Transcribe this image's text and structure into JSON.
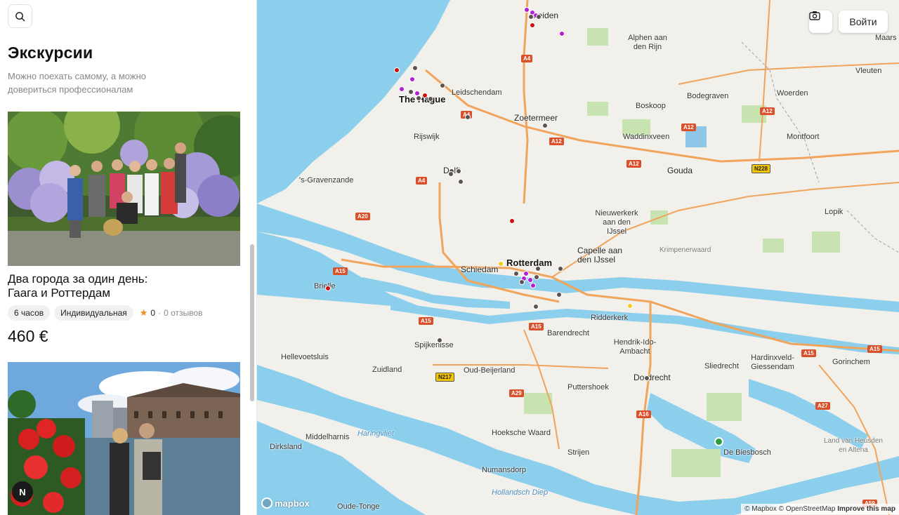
{
  "sidebar": {
    "title": "Экскурсии",
    "subtitle": "Можно поехать самому, а можно довериться профессионалам",
    "cards": [
      {
        "title": "Два города за один день: Гаага и Роттердам",
        "duration": "6 часов",
        "type": "Индивидуальная",
        "rating": "0",
        "reviews": "0 отзывов",
        "price": "460 €"
      },
      {
        "title": "",
        "duration": "",
        "type": "",
        "rating": "",
        "reviews": "",
        "price": ""
      }
    ],
    "badge": "N"
  },
  "map": {
    "login_label": "Войти",
    "mapbox_label": "mapbox",
    "attribution": {
      "mapbox": "© Mapbox",
      "osm": "© OpenStreetMap",
      "improve": "Improve this map"
    },
    "labels": {
      "leiden": "Leiden",
      "alphen": "Alphen aan den Rijn",
      "hague": "The Hague",
      "leidschendam": "Leidschendam",
      "zoetermeer": "Zoetermeer",
      "bodegraven": "Bodegraven",
      "boskoop": "Boskoop",
      "waddinxveen": "Waddinxveen",
      "rijswijk": "Rijswijk",
      "delft": "Delft",
      "gravenzande": "'s-Gravenzande",
      "gouda": "Gouda",
      "vleuten": "Vleuten",
      "woerden": "Woerden",
      "montfoort": "Montfoort",
      "lopik": "Lopik",
      "nieuwerkerk": "Nieuwerkerk aan den IJssel",
      "krimpenerwaard": "Krimpenerwaard",
      "capelle": "Capelle aan den IJssel",
      "rotterdam": "Rotterdam",
      "schiedam": "Schiedam",
      "brielle": "Brielle",
      "ridderkerk": "Ridderkerk",
      "barendrecht": "Barendrecht",
      "hendrik": "Hendrik-Ido-Ambacht",
      "hardinxveld": "Hardinxveld-Giessendam",
      "sliedrecht": "Sliedrecht",
      "gorinchem": "Gorinchem",
      "spijkenisse": "Spijkenisse",
      "hellevoetsluis": "Hellevoetsluis",
      "zuidland": "Zuidland",
      "oudbeijerland": "Oud-Beijerland",
      "puttershoek": "Puttershoek",
      "dordrecht": "Dordrecht",
      "middelharnis": "Middelharnis",
      "haringvliet": "Haringvliet",
      "hoeksche": "Hoeksche Waard",
      "strijen": "Strijen",
      "biesbosch": "De Biesbosch",
      "landheusden": "Land van Heusden en Altena",
      "dirksland": "Dirksland",
      "numansdorp": "Numansdorp",
      "hollandsch": "Hollandsch Diep",
      "oudetonge": "Oude-Tonge",
      "maars": "Maars"
    },
    "shields": {
      "a4a": "A4",
      "a4b": "A4",
      "a4c": "A4",
      "a12a": "A12",
      "a12b": "A12",
      "a12c": "A12",
      "a12d": "A12",
      "a20": "A20",
      "a15a": "A15",
      "a15b": "A15",
      "a15c": "A15",
      "a15d": "A15",
      "a15e": "A15",
      "a29": "A29",
      "a16": "A16",
      "a27": "A27",
      "a59": "A59",
      "n228": "N228",
      "n217": "N217"
    }
  }
}
